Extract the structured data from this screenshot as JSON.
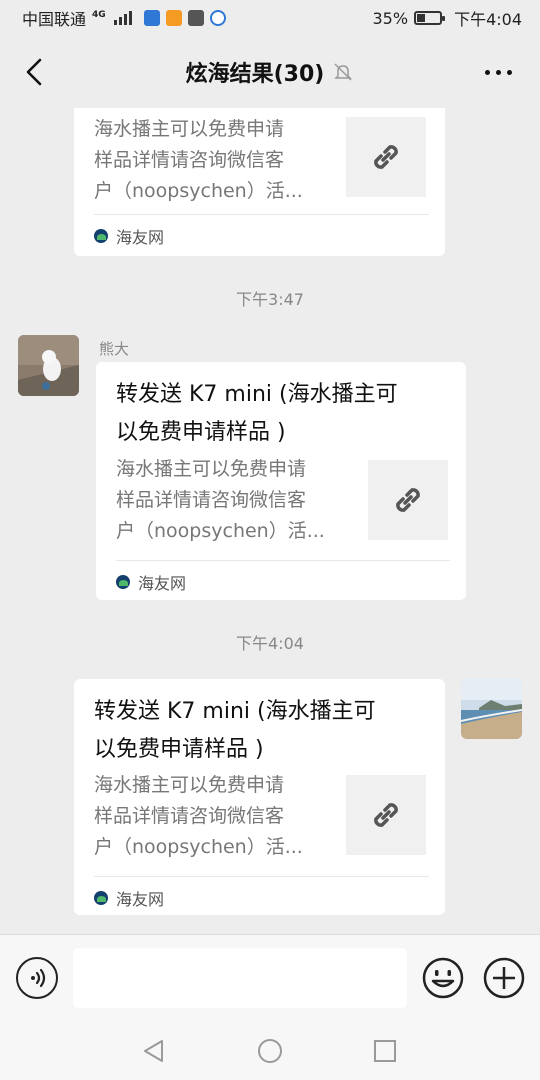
{
  "status_bar": {
    "carrier": "中国联通",
    "network": "4G",
    "battery": "35%",
    "battery_level": 0.35,
    "time": "下午4:04"
  },
  "header": {
    "title": "炫海结果(30)",
    "back_icon": "chevron-left-icon",
    "mute_icon": "bell-off-icon",
    "more_icon": "more-dots-icon"
  },
  "messages": [
    {
      "type": "link-card",
      "direction": "outgoing",
      "desc_lines": [
        "海水播主可以免费申请",
        "样品详情请咨询微信客",
        "户（noopsychen）活..."
      ],
      "source": "海友网"
    },
    {
      "type": "timestamp",
      "text": "下午3:47"
    },
    {
      "type": "link-card",
      "direction": "incoming",
      "sender": "熊大",
      "title_lines": [
        "转发送 K7 mini (海水播主可",
        "以免费申请样品 )"
      ],
      "desc_lines": [
        "海水播主可以免费申请",
        "样品详情请咨询微信客",
        "户（noopsychen）活..."
      ],
      "source": "海友网"
    },
    {
      "type": "timestamp",
      "text": "下午4:04"
    },
    {
      "type": "link-card",
      "direction": "outgoing",
      "title_lines": [
        "转发送 K7 mini (海水播主可",
        "以免费申请样品 )"
      ],
      "desc_lines": [
        "海水播主可以免费申请",
        "样品详情请咨询微信客",
        "户（noopsychen）活..."
      ],
      "source": "海友网"
    }
  ],
  "input_bar": {
    "voice_icon": "voice-icon",
    "emoji_icon": "emoji-icon",
    "plus_icon": "plus-icon",
    "text_value": ""
  },
  "nav_bar": {
    "back_icon": "nav-back-icon",
    "home_icon": "nav-home-icon",
    "recents_icon": "nav-recents-icon"
  }
}
